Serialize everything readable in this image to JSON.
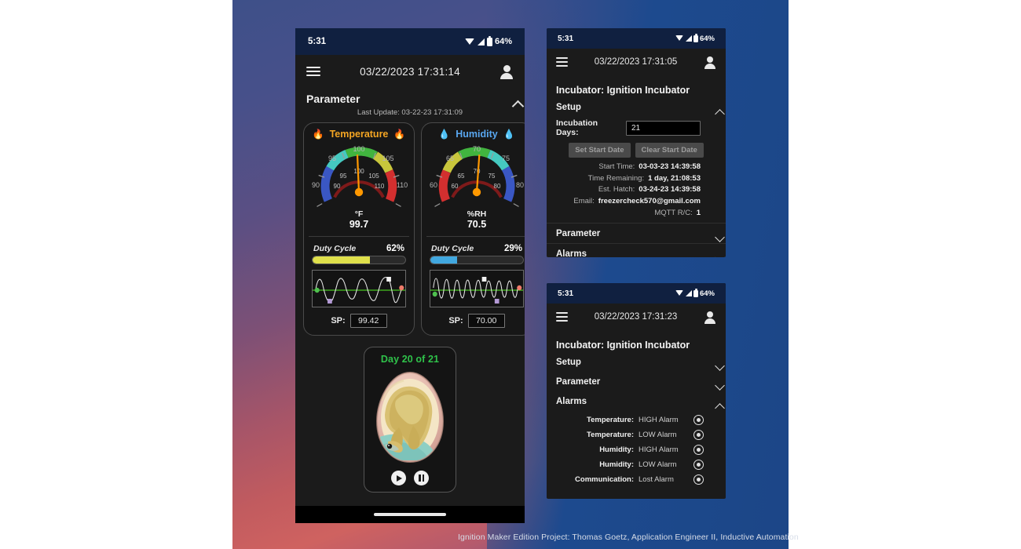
{
  "footer": {
    "credit": "Ignition Maker Edition Project: Thomas Goetz, Application Engineer II, Inductive Automation"
  },
  "phone_main": {
    "status": {
      "clock": "5:31",
      "battery": "64%"
    },
    "appbar": {
      "title": "03/22/2023 17:31:14",
      "menu_icon": "hamburger-icon",
      "account_icon": "account-icon"
    },
    "section": {
      "label": "Parameter",
      "chevron": "chevron-up-icon"
    },
    "last_update": "Last Update: 03-22-23 17:31:09",
    "temperature": {
      "title": "Temperature",
      "icon": "flame-icon",
      "unit": "°F",
      "value": "99.7",
      "gauge_min": 85,
      "gauge_max": 115,
      "needle": 99.7,
      "ticks": [
        "90",
        "95",
        "100",
        "105",
        "110"
      ],
      "inner_ticks": [
        "90",
        "95",
        "100",
        "105",
        "110"
      ],
      "duty_label": "Duty Cycle",
      "duty_pct": "62%",
      "duty_value": 62,
      "duty_color": "#dfe04b",
      "sp_label": "SP:",
      "sp_value": "99.42"
    },
    "humidity": {
      "title": "Humidity",
      "icon": "droplet-icon",
      "unit": "%RH",
      "value": "70.5",
      "gauge_min": 55,
      "gauge_max": 85,
      "needle": 70.5,
      "ticks": [
        "60",
        "65",
        "70",
        "75",
        "80"
      ],
      "inner_ticks": [
        "60",
        "65",
        "70",
        "75",
        "80"
      ],
      "duty_label": "Duty Cycle",
      "duty_pct": "29%",
      "duty_value": 29,
      "duty_color": "#41a8e0",
      "sp_label": "SP:",
      "sp_value": "70.00"
    },
    "egg": {
      "day_text": "Day 20 of 21",
      "image_alt": "incubating-egg-embryo",
      "play_icon": "play-icon",
      "pause_icon": "pause-icon"
    }
  },
  "phone_setup": {
    "status": {
      "clock": "5:31",
      "battery": "64%"
    },
    "appbar": {
      "title": "03/22/2023 17:31:05"
    },
    "panel_title": "Incubator: Ignition Incubator",
    "sections": [
      {
        "label": "Setup",
        "chevron": "chevron-up-icon",
        "expanded": true
      },
      {
        "label": "Parameter",
        "chevron": "chevron-down-icon",
        "expanded": false
      },
      {
        "label": "Alarms",
        "chevron": "chevron-down-icon",
        "expanded": false
      }
    ],
    "incubation_days_label": "Incubation Days:",
    "incubation_days_value": "21",
    "buttons": {
      "set_start": "Set Start Date",
      "clear_start": "Clear Start Date"
    },
    "details": [
      {
        "k": "Start Time:",
        "v": "03-03-23 14:39:58"
      },
      {
        "k": "Time Remaining:",
        "v": "1 day, 21:08:53"
      },
      {
        "k": "Est. Hatch:",
        "v": "03-24-23 14:39:58"
      },
      {
        "k": "Email:",
        "v": "freezercheck570@gmail.com"
      },
      {
        "k": "MQTT R/C:",
        "v": "1"
      }
    ]
  },
  "phone_alarms": {
    "status": {
      "clock": "5:31",
      "battery": "64%"
    },
    "appbar": {
      "title": "03/22/2023 17:31:23"
    },
    "panel_title": "Incubator: Ignition Incubator",
    "sections": [
      {
        "label": "Setup",
        "chevron": "chevron-down-icon",
        "expanded": false
      },
      {
        "label": "Parameter",
        "chevron": "chevron-down-icon",
        "expanded": false
      },
      {
        "label": "Alarms",
        "chevron": "chevron-up-icon",
        "expanded": true
      }
    ],
    "alarms": [
      {
        "k": "Temperature:",
        "v": "HIGH Alarm",
        "icon": "alarm-indicator-icon"
      },
      {
        "k": "Temperature:",
        "v": "LOW Alarm",
        "icon": "alarm-indicator-icon"
      },
      {
        "k": "Humidity:",
        "v": "HIGH Alarm",
        "icon": "alarm-indicator-icon"
      },
      {
        "k": "Humidity:",
        "v": "LOW Alarm",
        "icon": "alarm-indicator-icon"
      },
      {
        "k": "Communication:",
        "v": "Lost Alarm",
        "icon": "alarm-indicator-icon"
      }
    ]
  },
  "colors": {
    "status_bar": "#102040",
    "app_bg": "#1b1b1b",
    "temp_accent": "#f5a623",
    "hum_accent": "#59a7f0",
    "day_green": "#2fc24a",
    "needle": "#ff9800"
  }
}
